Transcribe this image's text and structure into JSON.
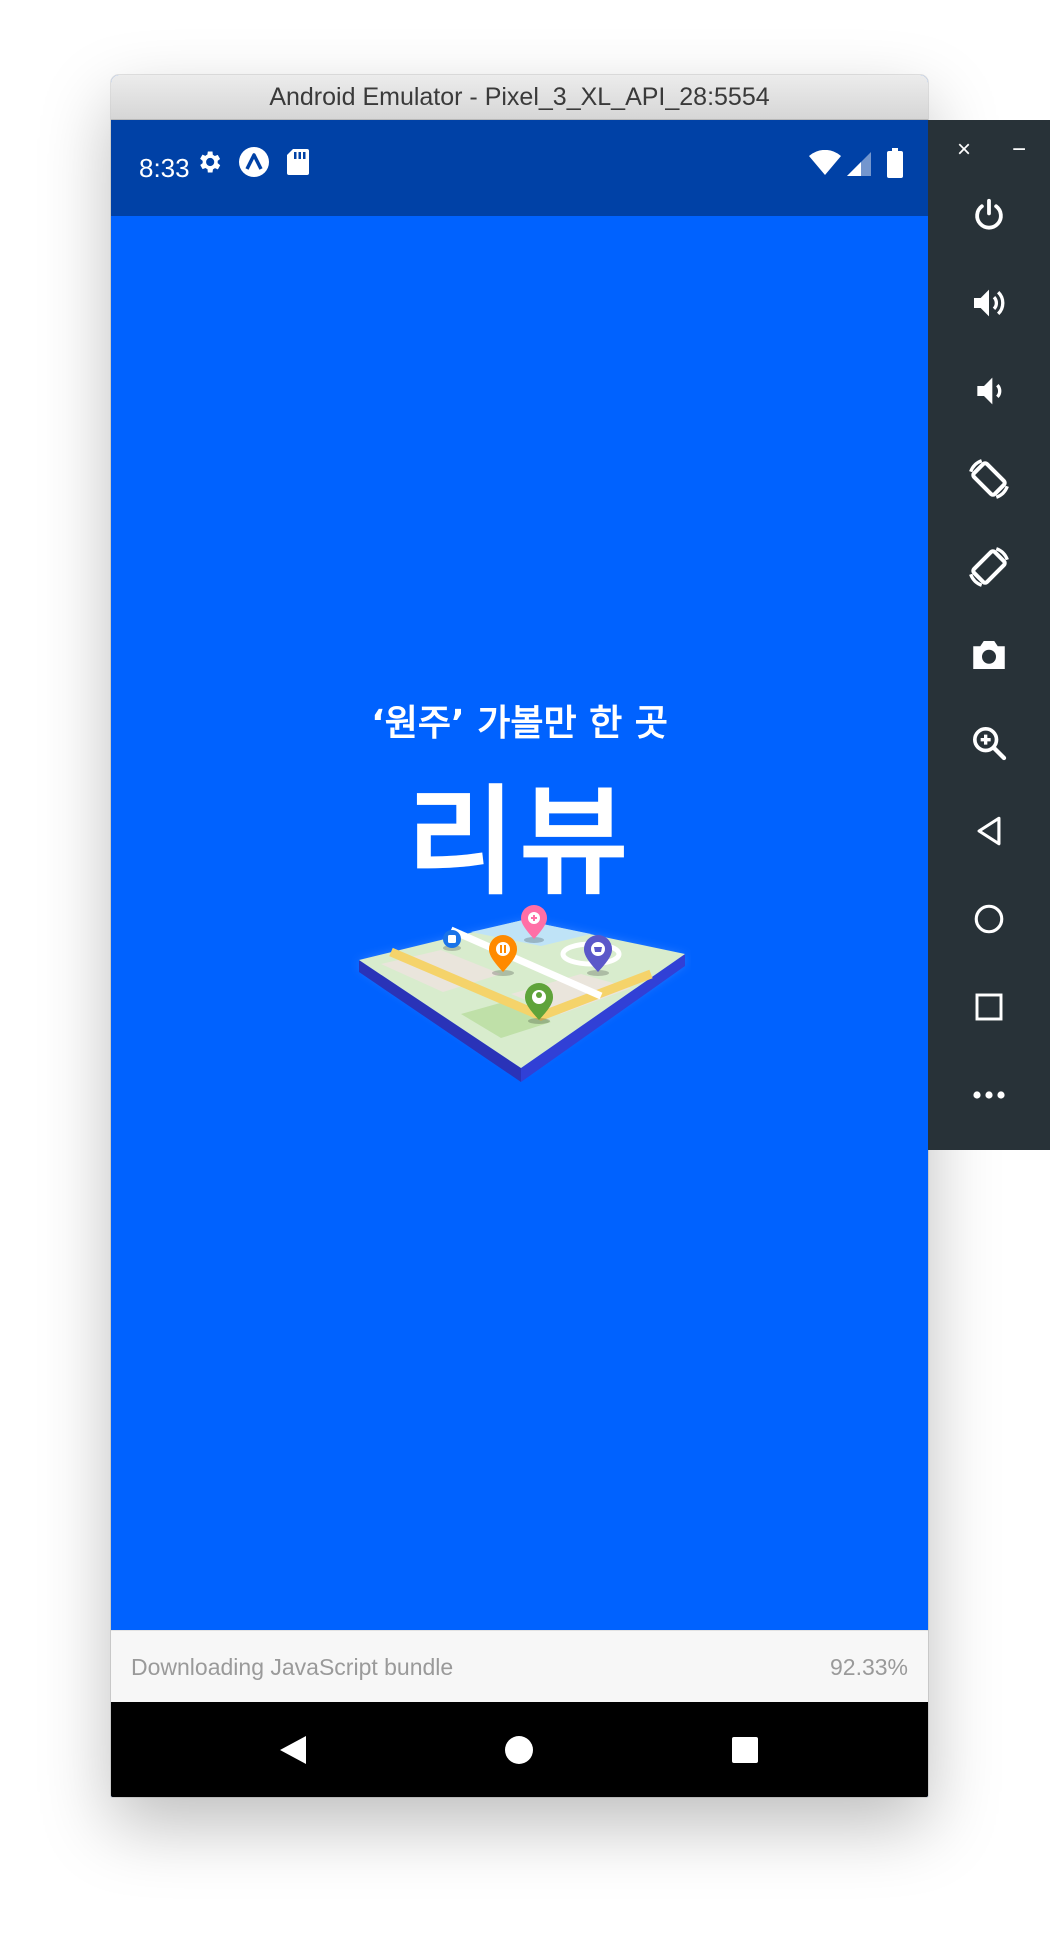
{
  "window": {
    "title": "Android Emulator - Pixel_3_XL_API_28:5554"
  },
  "status_bar": {
    "time": "8:33",
    "left_icons": [
      "gear-icon",
      "app-a-icon",
      "sd-card-icon"
    ],
    "right_icons": [
      "wifi-icon",
      "cell-signal-icon",
      "battery-icon"
    ]
  },
  "splash": {
    "tagline": "‘원주’ 가볼만 한 곳",
    "brand_name": "리뷰",
    "background_color": "#0062ff"
  },
  "loading_bar": {
    "message": "Downloading JavaScript bundle",
    "progress_text": "92.33%",
    "progress": 0.9233
  },
  "nav_bar": {
    "buttons": [
      "back-icon",
      "home-icon",
      "recents-icon"
    ]
  },
  "emulator_toolbar": {
    "close_label": "×",
    "minimize_label": "−",
    "buttons": [
      "power-icon",
      "volume-up-icon",
      "volume-down-icon",
      "rotate-left-icon",
      "rotate-right-icon",
      "camera-icon",
      "zoom-icon",
      "back-icon",
      "home-icon",
      "overview-icon",
      "more-icon"
    ]
  },
  "colors": {
    "status_bar": "#0041a6",
    "app_background": "#0062ff",
    "toolbar": "#283238"
  }
}
